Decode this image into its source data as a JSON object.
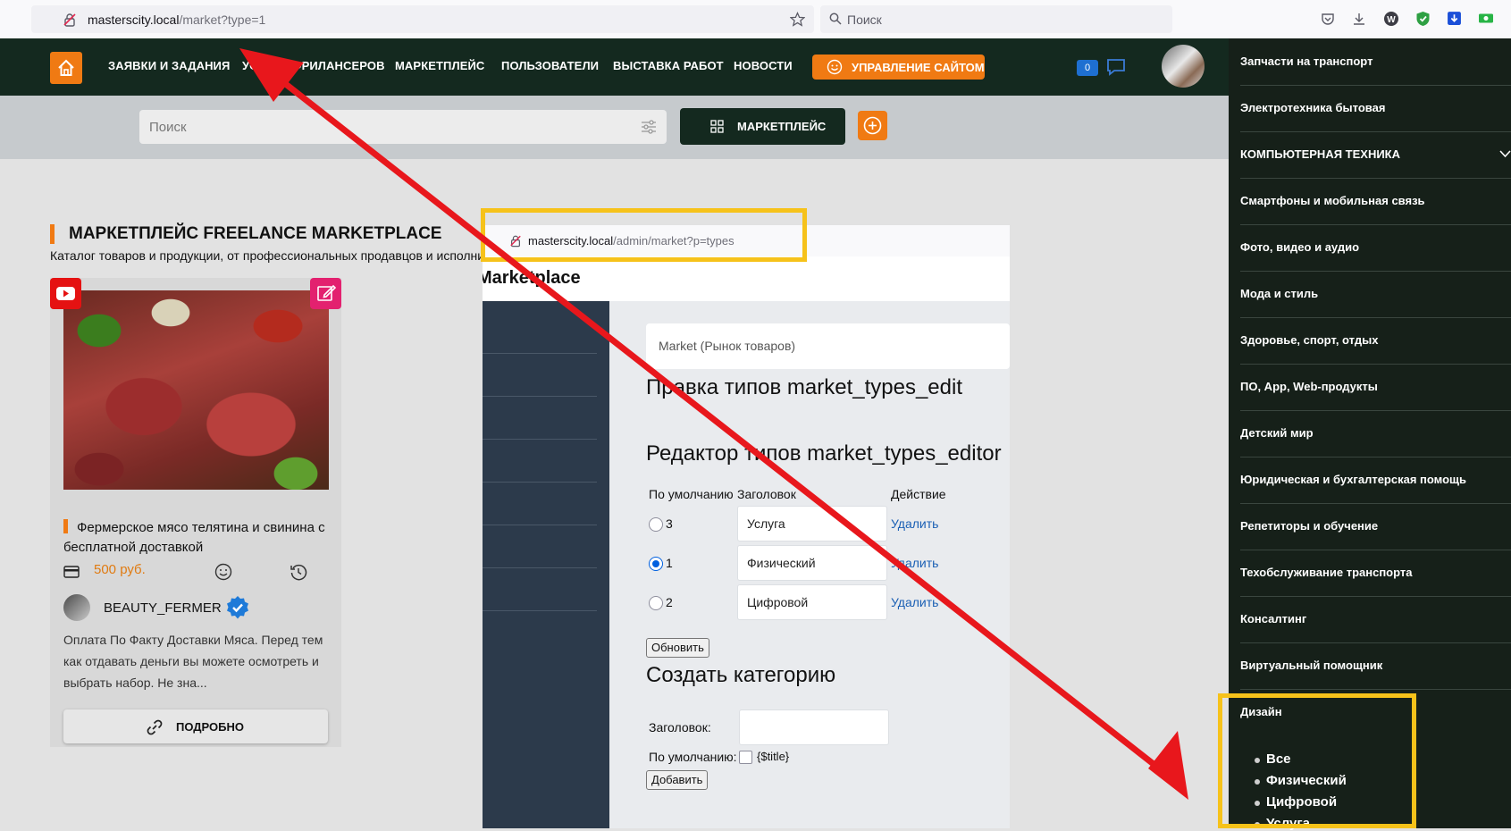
{
  "browser": {
    "url_host": "masterscity.local",
    "url_path": "/market?type=1",
    "search_placeholder": "Поиск"
  },
  "nav": {
    "items": [
      "ЗАЯВКИ И ЗАДАНИЯ",
      "УСЛУГИ ФРИЛАНСЕРОВ",
      "МАРКЕТПЛЕЙС",
      "ПОЛЬЗОВАТЕЛИ",
      "ВЫСТАВКА РАБОТ",
      "НОВОСТИ"
    ],
    "manage_label": "УПРАВЛЕНИЕ САЙТОМ",
    "messages_count": "0"
  },
  "search": {
    "placeholder": "Поиск",
    "market_button": "МАРКЕТПЛЕЙС"
  },
  "page": {
    "title": "МАРКЕТПЛЕЙС FREELANCE MARKETPLACE",
    "subtitle": "Каталог товаров и продукции, от профессиональных продавцов и исполнителей"
  },
  "product": {
    "title": "Фермерское мясо телятина и свинина с бесплатной доставкой",
    "price": "500 руб.",
    "seller": "BEAUTY_FERMER",
    "description": "Оплата По Факту Доставки Мяса. Перед тем как отдавать деньги вы можете осмотреть и выбрать набор. Не зна...",
    "more_label": "ПОДРОБНО"
  },
  "admin": {
    "url_host": "masterscity.local",
    "url_path": "/admin/market?p=types",
    "brand": "Marketplace",
    "breadcrumb": "Market (Рынок товаров)",
    "heading1": "Правка типов market_types_edit",
    "heading2": "Редактор типов market_types_editor",
    "col_default": "По умолчанию",
    "col_title": "Заголовок",
    "col_action": "Действие",
    "rows": [
      {
        "num": "3",
        "title": "Услуга",
        "action": "Удалить",
        "checked": false
      },
      {
        "num": "1",
        "title": "Физический",
        "action": "Удалить",
        "checked": true
      },
      {
        "num": "2",
        "title": "Цифровой",
        "action": "Удалить",
        "checked": false
      }
    ],
    "update_button": "Обновить",
    "create_heading": "Создать категорию",
    "label_title": "Заголовок:",
    "label_default": "По умолчанию:",
    "placeholder_token": "{$title}",
    "add_button": "Добавить"
  },
  "sidebar": {
    "categories": [
      "Запчасти на транспорт",
      "Электротехника бытовая",
      "КОМПЬЮТЕРНАЯ ТЕХНИКА",
      "Смартфоны и мобильная связь",
      "Фото, видео и аудио",
      "Мода и стиль",
      "Здоровье, спорт, отдых",
      "ПО, App, Web-продукты",
      "Детский мир",
      "Юридическая и бухгалтерская помощь",
      "Репетиторы и обучение",
      "Техобслуживание транспорта",
      "Консалтинг",
      "Виртуальный помощник",
      "Дизайн"
    ],
    "design_subtypes": [
      "Все",
      "Физический",
      "Цифровой",
      "Услуга"
    ]
  },
  "colors": {
    "accent": "#f07a13",
    "nav_bg": "#14291f",
    "highlight": "#f6c21a",
    "arrow": "#e8171c"
  }
}
